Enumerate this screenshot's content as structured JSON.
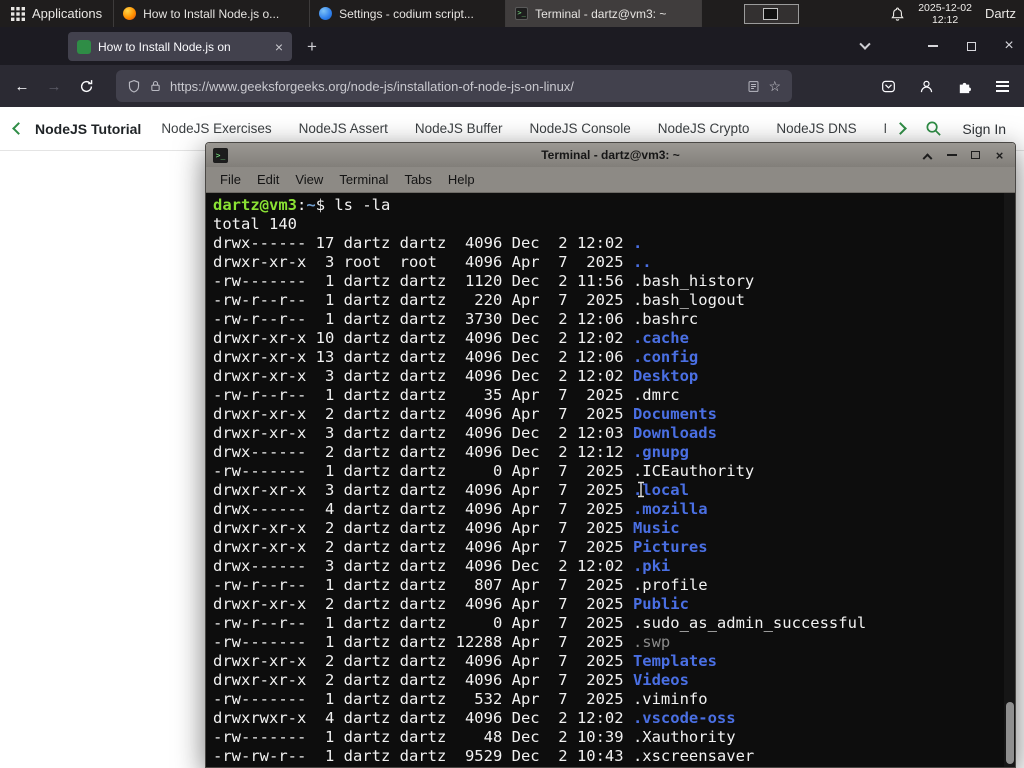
{
  "icons": {
    "close": "×",
    "plus": "+",
    "back": "←",
    "forward": "→",
    "star": "☆",
    "terminal_glyph": ">_"
  },
  "panel": {
    "applications": "Applications",
    "tasks": [
      {
        "icon": "firefox",
        "label": "How to Install Node.js o..."
      },
      {
        "icon": "codium",
        "label": "Settings - codium script..."
      },
      {
        "icon": "terminal",
        "label": "Terminal - dartz@vm3: ~",
        "active": true
      }
    ],
    "date": "2025-12-02",
    "time": "12:12",
    "user": "Dartz"
  },
  "browser": {
    "tab_title": "How to Install Node.js on",
    "url": "https://www.geeksforgeeks.org/node-js/installation-of-node-js-on-linux/"
  },
  "site_nav": {
    "title": "NodeJS Tutorial",
    "items": [
      "NodeJS Exercises",
      "NodeJS Assert",
      "NodeJS Buffer",
      "NodeJS Console",
      "NodeJS Crypto",
      "NodeJS DNS",
      "Node"
    ],
    "sign_in": "Sign In",
    "accent_green": "#2f8d46"
  },
  "terminal": {
    "title": "Terminal - dartz@vm3: ~",
    "menu": [
      "File",
      "Edit",
      "View",
      "Terminal",
      "Tabs",
      "Help"
    ],
    "colors": {
      "background": "#0d0d0d",
      "foreground": "#f2f2f2",
      "prompt_green": "#8ae234",
      "dir_blue": "#4a6fe3",
      "dim_gray": "#8a8a8a"
    },
    "lines": [
      [
        [
          "prompt",
          "dartz@vm3"
        ],
        [
          "fg",
          ":"
        ],
        [
          "path",
          "~"
        ],
        [
          "fg",
          "$ ls -la"
        ]
      ],
      [
        [
          "fg",
          "total 140"
        ]
      ],
      [
        [
          "fg",
          "drwx------ 17 dartz dartz  4096 Dec  2 12:02 "
        ],
        [
          "dir",
          "."
        ]
      ],
      [
        [
          "fg",
          "drwxr-xr-x  3 root  root   4096 Apr  7  2025 "
        ],
        [
          "dir",
          ".."
        ]
      ],
      [
        [
          "fg",
          "-rw-------  1 dartz dartz  1120 Dec  2 11:56 "
        ],
        [
          "fg",
          ".bash_history"
        ]
      ],
      [
        [
          "fg",
          "-rw-r--r--  1 dartz dartz   220 Apr  7  2025 "
        ],
        [
          "fg",
          ".bash_logout"
        ]
      ],
      [
        [
          "fg",
          "-rw-r--r--  1 dartz dartz  3730 Dec  2 12:06 "
        ],
        [
          "fg",
          ".bashrc"
        ]
      ],
      [
        [
          "fg",
          "drwxr-xr-x 10 dartz dartz  4096 Dec  2 12:02 "
        ],
        [
          "dir",
          ".cache"
        ]
      ],
      [
        [
          "fg",
          "drwxr-xr-x 13 dartz dartz  4096 Dec  2 12:06 "
        ],
        [
          "dir",
          ".config"
        ]
      ],
      [
        [
          "fg",
          "drwxr-xr-x  3 dartz dartz  4096 Dec  2 12:02 "
        ],
        [
          "dir",
          "Desktop"
        ]
      ],
      [
        [
          "fg",
          "-rw-r--r--  1 dartz dartz    35 Apr  7  2025 "
        ],
        [
          "fg",
          ".dmrc"
        ]
      ],
      [
        [
          "fg",
          "drwxr-xr-x  2 dartz dartz  4096 Apr  7  2025 "
        ],
        [
          "dir",
          "Documents"
        ]
      ],
      [
        [
          "fg",
          "drwxr-xr-x  3 dartz dartz  4096 Dec  2 12:03 "
        ],
        [
          "dir",
          "Downloads"
        ]
      ],
      [
        [
          "fg",
          "drwx------  2 dartz dartz  4096 Dec  2 12:12 "
        ],
        [
          "dir",
          ".gnupg"
        ]
      ],
      [
        [
          "fg",
          "-rw-------  1 dartz dartz     0 Apr  7  2025 "
        ],
        [
          "fg",
          ".ICEauthority"
        ]
      ],
      [
        [
          "fg",
          "drwxr-xr-x  3 dartz dartz  4096 Apr  7  2025 "
        ],
        [
          "dir",
          ".local"
        ]
      ],
      [
        [
          "fg",
          "drwx------  4 dartz dartz  4096 Apr  7  2025 "
        ],
        [
          "dir",
          ".mozilla"
        ]
      ],
      [
        [
          "fg",
          "drwxr-xr-x  2 dartz dartz  4096 Apr  7  2025 "
        ],
        [
          "dir",
          "Music"
        ]
      ],
      [
        [
          "fg",
          "drwxr-xr-x  2 dartz dartz  4096 Apr  7  2025 "
        ],
        [
          "dir",
          "Pictures"
        ]
      ],
      [
        [
          "fg",
          "drwx------  3 dartz dartz  4096 Dec  2 12:02 "
        ],
        [
          "dir",
          ".pki"
        ]
      ],
      [
        [
          "fg",
          "-rw-r--r--  1 dartz dartz   807 Apr  7  2025 "
        ],
        [
          "fg",
          ".profile"
        ]
      ],
      [
        [
          "fg",
          "drwxr-xr-x  2 dartz dartz  4096 Apr  7  2025 "
        ],
        [
          "dir",
          "Public"
        ]
      ],
      [
        [
          "fg",
          "-rw-r--r--  1 dartz dartz     0 Apr  7  2025 "
        ],
        [
          "fg",
          ".sudo_as_admin_successful"
        ]
      ],
      [
        [
          "fg",
          "-rw-------  1 dartz dartz 12288 Apr  7  2025 "
        ],
        [
          "dim",
          ".swp"
        ]
      ],
      [
        [
          "fg",
          "drwxr-xr-x  2 dartz dartz  4096 Apr  7  2025 "
        ],
        [
          "dir",
          "Templates"
        ]
      ],
      [
        [
          "fg",
          "drwxr-xr-x  2 dartz dartz  4096 Apr  7  2025 "
        ],
        [
          "dir",
          "Videos"
        ]
      ],
      [
        [
          "fg",
          "-rw-------  1 dartz dartz   532 Apr  7  2025 "
        ],
        [
          "fg",
          ".viminfo"
        ]
      ],
      [
        [
          "fg",
          "drwxrwxr-x  4 dartz dartz  4096 Dec  2 12:02 "
        ],
        [
          "dir",
          ".vscode-oss"
        ]
      ],
      [
        [
          "fg",
          "-rw-------  1 dartz dartz    48 Dec  2 10:39 "
        ],
        [
          "fg",
          ".Xauthority"
        ]
      ],
      [
        [
          "fg",
          "-rw-rw-r--  1 dartz dartz  9529 Dec  2 10:43 "
        ],
        [
          "fg",
          ".xscreensaver"
        ]
      ]
    ]
  }
}
